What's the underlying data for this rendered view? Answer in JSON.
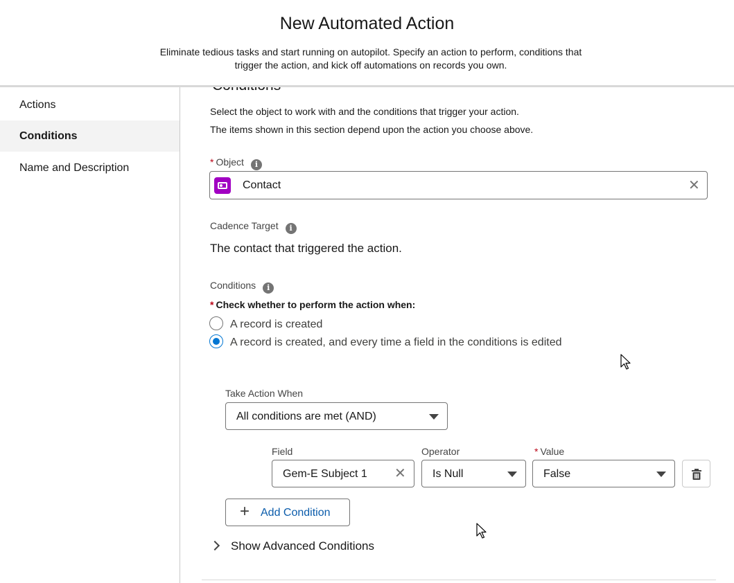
{
  "header": {
    "title": "New Automated Action",
    "tagline_line1": "Eliminate tedious tasks and start running on autopilot. Specify an action to perform, conditions that",
    "tagline_line2": "trigger the action, and kick off automations on records you own."
  },
  "sidebar": {
    "items": [
      {
        "label": "Actions"
      },
      {
        "label": "Conditions",
        "active": true
      },
      {
        "label": "Name and Description"
      }
    ]
  },
  "section": {
    "heading": "Conditions",
    "desc_line1": "Select the object to work with and the conditions that trigger your action.",
    "desc_line2": "The items shown in this section depend upon the action you choose above."
  },
  "object": {
    "label": "Object",
    "value": "Contact",
    "icon": "contact-card-icon",
    "icon_color": "#a100c2"
  },
  "cadence": {
    "label": "Cadence Target",
    "text": "The contact that triggered the action."
  },
  "conditions": {
    "label": "Conditions",
    "check_label": "Check whether to perform the action when:",
    "options": [
      {
        "label": "A record is created",
        "checked": false
      },
      {
        "label": "A record is created, and every time a field in the conditions is edited",
        "checked": true
      }
    ],
    "take_action_label": "Take Action When",
    "take_action_value": "All conditions are met (AND)",
    "field_label": "Field",
    "operator_label": "Operator",
    "value_label": "Value",
    "row": {
      "field": "Gem-E Subject 1",
      "operator": "Is Null",
      "value": "False"
    },
    "add_button": "Add Condition",
    "advanced_toggle": "Show Advanced Conditions"
  },
  "colors": {
    "accent": "#0176d3",
    "required": "#ba0517"
  }
}
